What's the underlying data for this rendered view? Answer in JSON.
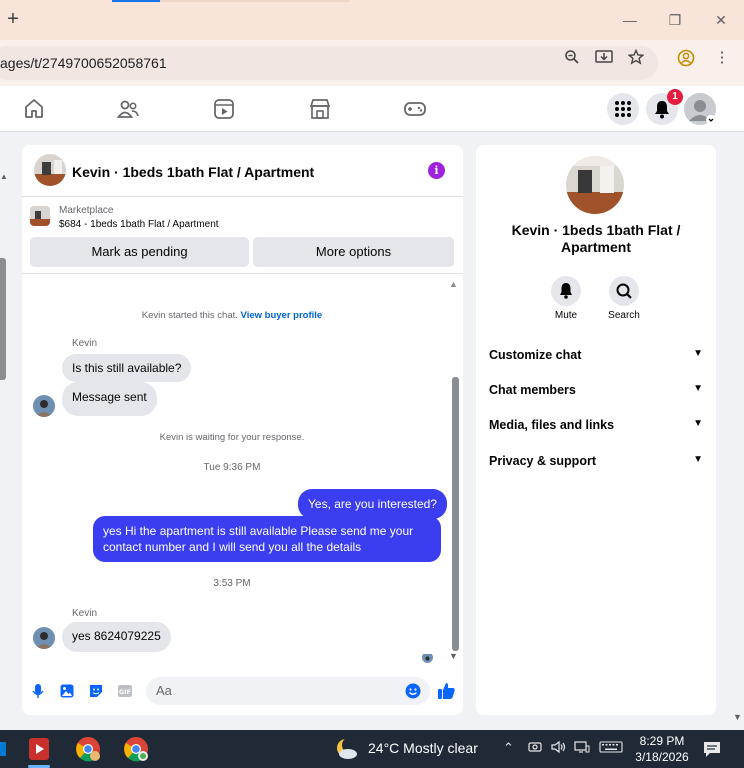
{
  "browser": {
    "url": "ages/t/2749700652058761"
  },
  "notifications": {
    "count": "1"
  },
  "chat": {
    "title": "Kevin · 1beds 1bath Flat / Apartment",
    "marketplace_label": "Marketplace",
    "listing": "$684 - 1beds 1bath Flat / Apartment",
    "mark_pending_label": "Mark as pending",
    "more_options_label": "More options",
    "started_text": "Kevin started this chat.",
    "view_profile_link": "View buyer profile",
    "messages": [
      {
        "sender": "Kevin",
        "text": "Is this still available?"
      },
      {
        "text": "Message sent"
      },
      {
        "system": "Kevin is waiting for your response."
      },
      {
        "timestamp": "Tue 9:36 PM"
      },
      {
        "out": "Yes, are you interested?"
      },
      {
        "out": "yes Hi the apartment is still available Please send me your contact number and I will send you all the details"
      },
      {
        "timestamp": "3:53 PM"
      },
      {
        "sender": "Kevin",
        "text": "yes 8624079225"
      }
    ],
    "composer_placeholder": "Aa"
  },
  "info": {
    "name": "Kevin · 1beds 1bath Flat / Apartment",
    "mute_label": "Mute",
    "search_label": "Search",
    "sections": [
      "Customize chat",
      "Chat members",
      "Media, files and links",
      "Privacy & support"
    ]
  },
  "taskbar": {
    "weather": "24°C  Mostly clear",
    "time": "8:29 PM",
    "date": "3/18/2026"
  },
  "colors": {
    "accent_blue": "#3a3ef0",
    "titlebar": "#f9e4da",
    "link": "#0064d1",
    "info_purple": "#a020e0"
  }
}
